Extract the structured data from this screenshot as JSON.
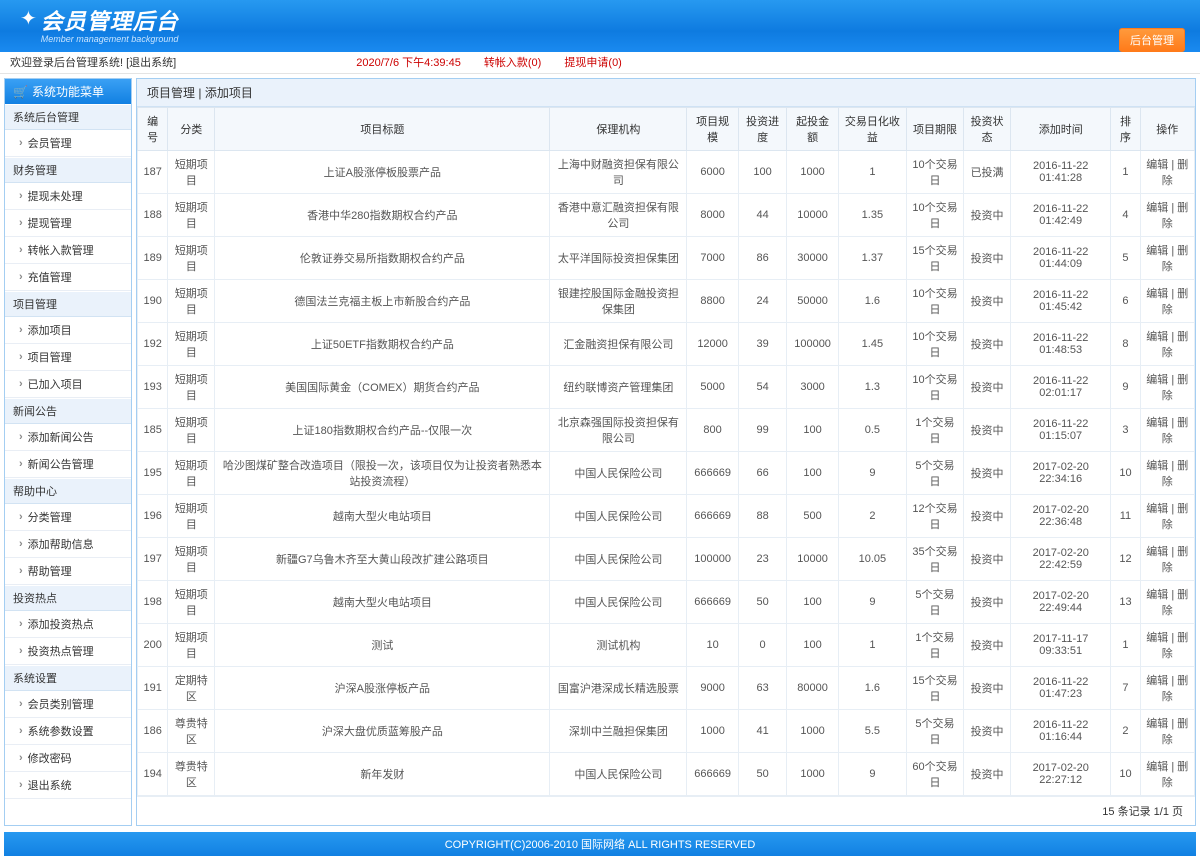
{
  "logo": {
    "title": "会员管理后台",
    "subtitle": "Member management background"
  },
  "back_button": "后台管理",
  "topbar": {
    "welcome": "欢迎登录后台管理系统!",
    "logout": "[退出系统]",
    "time": "2020/7/6 下午4:39:45",
    "transfer": "转帐入款(0)",
    "withdraw": "提现申请(0)"
  },
  "sidebar": {
    "title": "系统功能菜单",
    "groups": [
      {
        "label": "系统后台管理",
        "items": [
          "会员管理"
        ]
      },
      {
        "label": "财务管理",
        "items": [
          "提现未处理",
          "提现管理",
          "转帐入款管理",
          "充值管理"
        ]
      },
      {
        "label": "项目管理",
        "items": [
          "添加项目",
          "项目管理",
          "已加入项目"
        ]
      },
      {
        "label": "新闻公告",
        "items": [
          "添加新闻公告",
          "新闻公告管理"
        ]
      },
      {
        "label": "帮助中心",
        "items": [
          "分类管理",
          "添加帮助信息",
          "帮助管理"
        ]
      },
      {
        "label": "投资热点",
        "items": [
          "添加投资热点",
          "投资热点管理"
        ]
      },
      {
        "label": "系统设置",
        "items": [
          "会员类别管理",
          "系统参数设置",
          "修改密码",
          "退出系统"
        ]
      }
    ]
  },
  "crumb": {
    "a": "项目管理",
    "sep": " | ",
    "b": "添加项目"
  },
  "table": {
    "headers": [
      "编号",
      "分类",
      "项目标题",
      "保理机构",
      "项目规模",
      "投资进度",
      "起投金额",
      "交易日化收益",
      "项目期限",
      "投资状态",
      "添加时间",
      "排序",
      "操作"
    ],
    "action": {
      "edit": "编辑",
      "del": "删除",
      "sep": " | "
    },
    "rows": [
      [
        "187",
        "短期项目",
        "上证A股涨停板股票产品",
        "上海中财融资担保有限公司",
        "6000",
        "100",
        "1000",
        "1",
        "10个交易日",
        "已投满",
        "2016-11-22 01:41:28",
        "1"
      ],
      [
        "188",
        "短期项目",
        "香港中华280指数期权合约产品",
        "香港中意汇融资担保有限公司",
        "8000",
        "44",
        "10000",
        "1.35",
        "10个交易日",
        "投资中",
        "2016-11-22 01:42:49",
        "4"
      ],
      [
        "189",
        "短期项目",
        "伦敦证券交易所指数期权合约产品",
        "太平洋国际投资担保集团",
        "7000",
        "86",
        "30000",
        "1.37",
        "15个交易日",
        "投资中",
        "2016-11-22 01:44:09",
        "5"
      ],
      [
        "190",
        "短期项目",
        "德国法兰克福主板上市新股合约产品",
        "银建控股国际金融投资担保集团",
        "8800",
        "24",
        "50000",
        "1.6",
        "10个交易日",
        "投资中",
        "2016-11-22 01:45:42",
        "6"
      ],
      [
        "192",
        "短期项目",
        "上证50ETF指数期权合约产品",
        "汇金融资担保有限公司",
        "12000",
        "39",
        "100000",
        "1.45",
        "10个交易日",
        "投资中",
        "2016-11-22 01:48:53",
        "8"
      ],
      [
        "193",
        "短期项目",
        "美国国际黄金（COMEX）期货合约产品",
        "纽约联博资产管理集团",
        "5000",
        "54",
        "3000",
        "1.3",
        "10个交易日",
        "投资中",
        "2016-11-22 02:01:17",
        "9"
      ],
      [
        "185",
        "短期项目",
        "上证180指数期权合约产品--仅限一次",
        "北京森强国际投资担保有限公司",
        "800",
        "99",
        "100",
        "0.5",
        "1个交易日",
        "投资中",
        "2016-11-22 01:15:07",
        "3"
      ],
      [
        "195",
        "短期项目",
        "哈沙图煤矿整合改造项目（限投一次，该项目仅为让投资者熟悉本站投资流程）",
        "中国人民保险公司",
        "666669",
        "66",
        "100",
        "9",
        "5个交易日",
        "投资中",
        "2017-02-20 22:34:16",
        "10"
      ],
      [
        "196",
        "短期项目",
        "越南大型火电站项目",
        "中国人民保险公司",
        "666669",
        "88",
        "500",
        "2",
        "12个交易日",
        "投资中",
        "2017-02-20 22:36:48",
        "11"
      ],
      [
        "197",
        "短期项目",
        "新疆G7乌鲁木齐至大黄山段改扩建公路项目",
        "中国人民保险公司",
        "100000",
        "23",
        "10000",
        "10.05",
        "35个交易日",
        "投资中",
        "2017-02-20 22:42:59",
        "12"
      ],
      [
        "198",
        "短期项目",
        "越南大型火电站项目",
        "中国人民保险公司",
        "666669",
        "50",
        "100",
        "9",
        "5个交易日",
        "投资中",
        "2017-02-20 22:49:44",
        "13"
      ],
      [
        "200",
        "短期项目",
        "测试",
        "测试机构",
        "10",
        "0",
        "100",
        "1",
        "1个交易日",
        "投资中",
        "2017-11-17 09:33:51",
        "1"
      ],
      [
        "191",
        "定期特区",
        "沪深A股涨停板产品",
        "国富沪港深成长精选股票",
        "9000",
        "63",
        "80000",
        "1.6",
        "15个交易日",
        "投资中",
        "2016-11-22 01:47:23",
        "7"
      ],
      [
        "186",
        "尊贵特区",
        "沪深大盘优质蓝筹股产品",
        "深圳中兰融担保集团",
        "1000",
        "41",
        "1000",
        "5.5",
        "5个交易日",
        "投资中",
        "2016-11-22 01:16:44",
        "2"
      ],
      [
        "194",
        "尊贵特区",
        "新年发财",
        "中国人民保险公司",
        "666669",
        "50",
        "1000",
        "9",
        "60个交易日",
        "投资中",
        "2017-02-20 22:27:12",
        "10"
      ]
    ],
    "footer": "15 条记录 1/1 页"
  },
  "footer": "COPYRIGHT(C)2006-2010 国际网络 ALL RIGHTS RESERVED"
}
